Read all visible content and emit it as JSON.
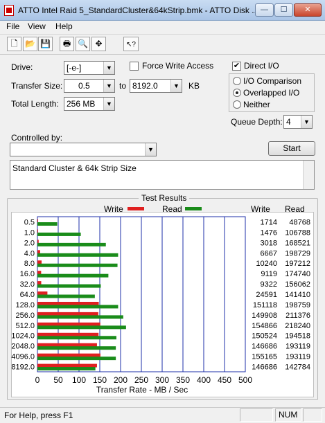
{
  "window": {
    "title": "ATTO Intel Raid 5_StandardCluster&64kStrip.bmk - ATTO Disk ...",
    "min_glyph": "—",
    "max_glyph": "☐",
    "close_glyph": "✕"
  },
  "menu": [
    "File",
    "View",
    "Help"
  ],
  "toolbar": [
    {
      "icon": "new-document-icon",
      "glyph": "🗋"
    },
    {
      "icon": "open-folder-icon",
      "glyph": "📂"
    },
    {
      "icon": "save-icon",
      "glyph": "💾"
    },
    {
      "icon": "print-icon",
      "glyph": "🖶"
    },
    {
      "icon": "print-preview-icon",
      "glyph": "🔍"
    },
    {
      "icon": "move-icon",
      "glyph": "✥"
    },
    {
      "icon": "help-cursor-icon",
      "glyph": "↖?"
    }
  ],
  "form": {
    "drive_label": "Drive:",
    "drive_value": "[-e-]",
    "transfer_size_label": "Transfer Size:",
    "transfer_from": "0.5",
    "to_label": "to",
    "transfer_to": "8192.0",
    "kb_label": "KB",
    "total_length_label": "Total Length:",
    "total_length_value": "256 MB",
    "force_write_label": "Force Write Access",
    "force_write_checked": false,
    "direct_io_label": "Direct I/O",
    "direct_io_checked": true,
    "direct_io_glyph": "✔",
    "radio_options": [
      "I/O Comparison",
      "Overlapped I/O",
      "Neither"
    ],
    "radio_selected": 1,
    "queue_depth_label": "Queue Depth:",
    "queue_depth_value": "4",
    "controlled_by_label": "Controlled by:",
    "controlled_by_value": "",
    "start_label": "Start",
    "description": "Standard Cluster & 64k Strip Size"
  },
  "results": {
    "group_title": "Test Results",
    "write_legend": "Write",
    "read_legend": "Read",
    "write_col": "Write",
    "read_col": "Read"
  },
  "colors": {
    "write": "#e02020",
    "read": "#1a8c1a",
    "grid": "#1d2fa8"
  },
  "chart_data": {
    "type": "bar",
    "orientation": "horizontal",
    "categories": [
      "0.5",
      "1.0",
      "2.0",
      "4.0",
      "8.0",
      "16.0",
      "32.0",
      "64.0",
      "128.0",
      "256.0",
      "512.0",
      "1024.0",
      "2048.0",
      "4096.0",
      "8192.0"
    ],
    "series": [
      {
        "name": "Write",
        "values": [
          1714,
          1476,
          3018,
          6667,
          10240,
          9119,
          9322,
          24591,
          151118,
          149908,
          154866,
          150524,
          146686,
          155165,
          146686
        ]
      },
      {
        "name": "Read",
        "values": [
          48768,
          106788,
          168521,
          198729,
          197212,
          174740,
          156062,
          141410,
          198759,
          211376,
          218240,
          194518,
          193119,
          193119,
          142784
        ]
      }
    ],
    "xlabel": "Transfer Rate - MB / Sec",
    "xticks": [
      "0",
      "50",
      "100",
      "150",
      "200",
      "250",
      "300",
      "350",
      "400",
      "450",
      "500"
    ],
    "xlim": [
      0,
      500
    ],
    "value_units": "KB/s",
    "grid": true,
    "legend": "top"
  },
  "status": {
    "help_text": "For Help, press F1",
    "num": "NUM"
  }
}
